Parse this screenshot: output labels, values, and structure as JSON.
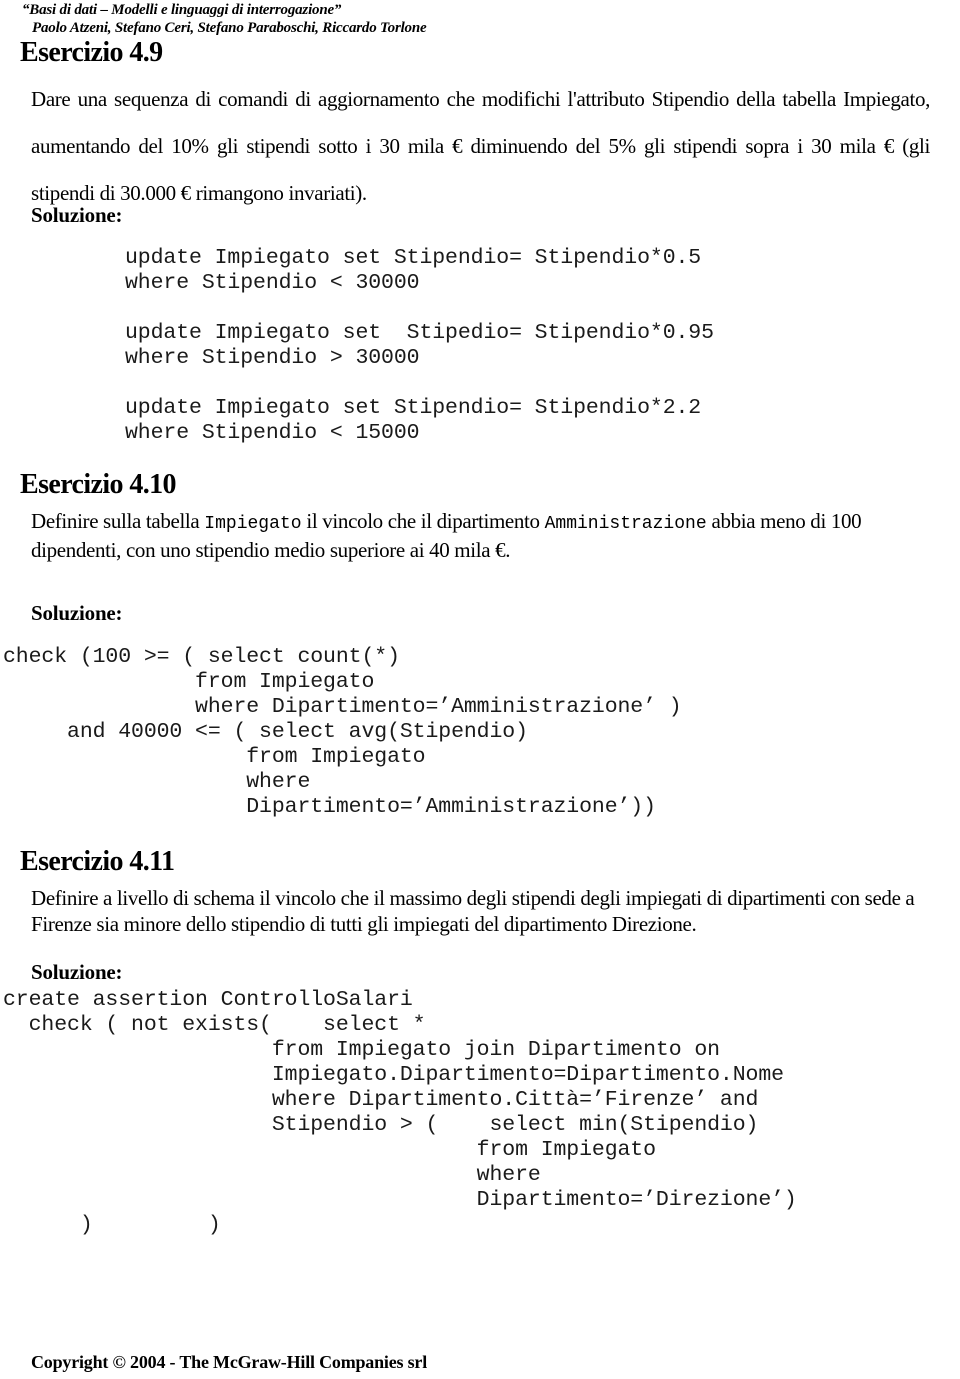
{
  "header": {
    "book_title": "“Basi di dati – Modelli e linguaggi di interrogazione”",
    "authors": "Paolo Atzeni, Stefano Ceri, Stefano Paraboschi, Riccardo Torlone"
  },
  "footer": {
    "copyright": "Copyright © 2004 - The McGraw-Hill Companies srl"
  },
  "labels": {
    "soluzione": "Soluzione:"
  },
  "exercises": [
    {
      "heading": "Esercizio 4.9",
      "statement_part1": "Dare una sequenza di comandi di aggiornamento che modifichi l'attributo Stipendio della tabella Impiegato, aumentando del 10% gli stipendi sotto i 30 mila € diminuendo del 5% gli stipendi sopra i 30 mila € (gli stipendi di 30.000 € rimangono invariati).",
      "code": "update Impiegato set Stipendio= Stipendio*0.5\nwhere Stipendio < 30000\n\nupdate Impiegato set  Stipedio= Stipendio*0.95\nwhere Stipendio > 30000\n\nupdate Impiegato set Stipendio= Stipendio*2.2\nwhere Stipendio < 15000"
    },
    {
      "heading": "Esercizio 4.10",
      "statement_a": "Definire sulla tabella ",
      "statement_mono1": "Impiegato",
      "statement_b": " il vincolo che il dipartimento ",
      "statement_mono2": "Amministrazione",
      "statement_c": " abbia meno di 100 dipendenti, con uno stipendio medio superiore ai 40 mila €.",
      "code": "check (100 >= ( select count(*)\n               from Impiegato\n               where Dipartimento=’Amministrazione’ )\n     and 40000 <= ( select avg(Stipendio)\n                   from Impiegato\n                   where\n                   Dipartimento=’Amministrazione’))"
    },
    {
      "heading": "Esercizio 4.11",
      "statement": "Definire a livello di schema il vincolo che il massimo degli stipendi degli impiegati di dipartimenti con sede a Firenze sia minore dello stipendio di tutti gli impiegati del dipartimento Direzione.",
      "code": "create assertion ControlloSalari\n  check ( not exists(    select *\n                     from Impiegato join Dipartimento on\n                     Impiegato.Dipartimento=Dipartimento.Nome\n                     where Dipartimento.Città=’Firenze’ and\n                     Stipendio > (    select min(Stipendio)\n                                     from Impiegato\n                                     where\n                                     Dipartimento=’Direzione’)\n      )         )"
    }
  ]
}
